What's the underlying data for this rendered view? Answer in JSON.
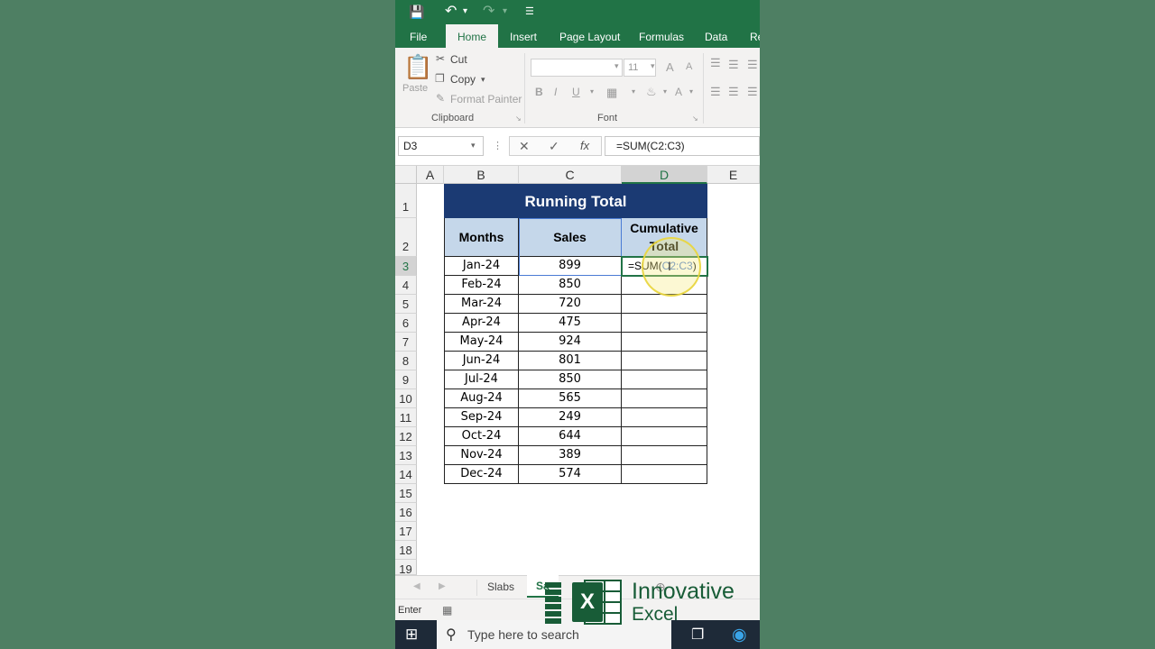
{
  "ribbon_tabs": [
    "File",
    "Home",
    "Insert",
    "Page Layout",
    "Formulas",
    "Data",
    "Re"
  ],
  "clipboard": {
    "paste": "Paste",
    "cut": "Cut",
    "copy": "Copy",
    "format_painter": "Format Painter",
    "group_label": "Clipboard"
  },
  "font": {
    "size": "11",
    "bold": "B",
    "italic": "I",
    "underline": "U",
    "grow": "A",
    "shrink": "A",
    "color": "A",
    "group_label": "Font"
  },
  "formula_bar": {
    "name_box": "D3",
    "formula": "=SUM(C2:C3)",
    "fx": "fx"
  },
  "columns": [
    "A",
    "B",
    "C",
    "D",
    "E"
  ],
  "rows": [
    "1",
    "2",
    "3",
    "4",
    "5",
    "6",
    "7",
    "8",
    "9",
    "10",
    "11",
    "12",
    "13",
    "14",
    "15",
    "16",
    "17",
    "18",
    "19"
  ],
  "table": {
    "title": "Running Total",
    "headers": [
      "Months",
      "Sales",
      "Cumulative Total"
    ],
    "months": [
      "Jan-24",
      "Feb-24",
      "Mar-24",
      "Apr-24",
      "May-24",
      "Jun-24",
      "Jul-24",
      "Aug-24",
      "Sep-24",
      "Oct-24",
      "Nov-24",
      "Dec-24"
    ],
    "sales": [
      "899",
      "850",
      "720",
      "475",
      "924",
      "801",
      "850",
      "565",
      "249",
      "644",
      "389",
      "574"
    ],
    "edit_prefix": "=SUM(",
    "edit_ref": "C2:C3",
    "edit_suffix": ")"
  },
  "sheet_tabs": [
    "Slabs",
    "Sa"
  ],
  "status": "Enter",
  "taskbar": {
    "search_placeholder": "Type here to search"
  },
  "watermark": {
    "line1": "Innovative",
    "line2": "Excel",
    "x": "X"
  },
  "colors": {
    "excel_green": "#217346",
    "title_fill": "#1b3a73",
    "header_fill": "#c5d7ea",
    "ref_blue": "#4a7bd4",
    "background": "#4e7f63"
  }
}
